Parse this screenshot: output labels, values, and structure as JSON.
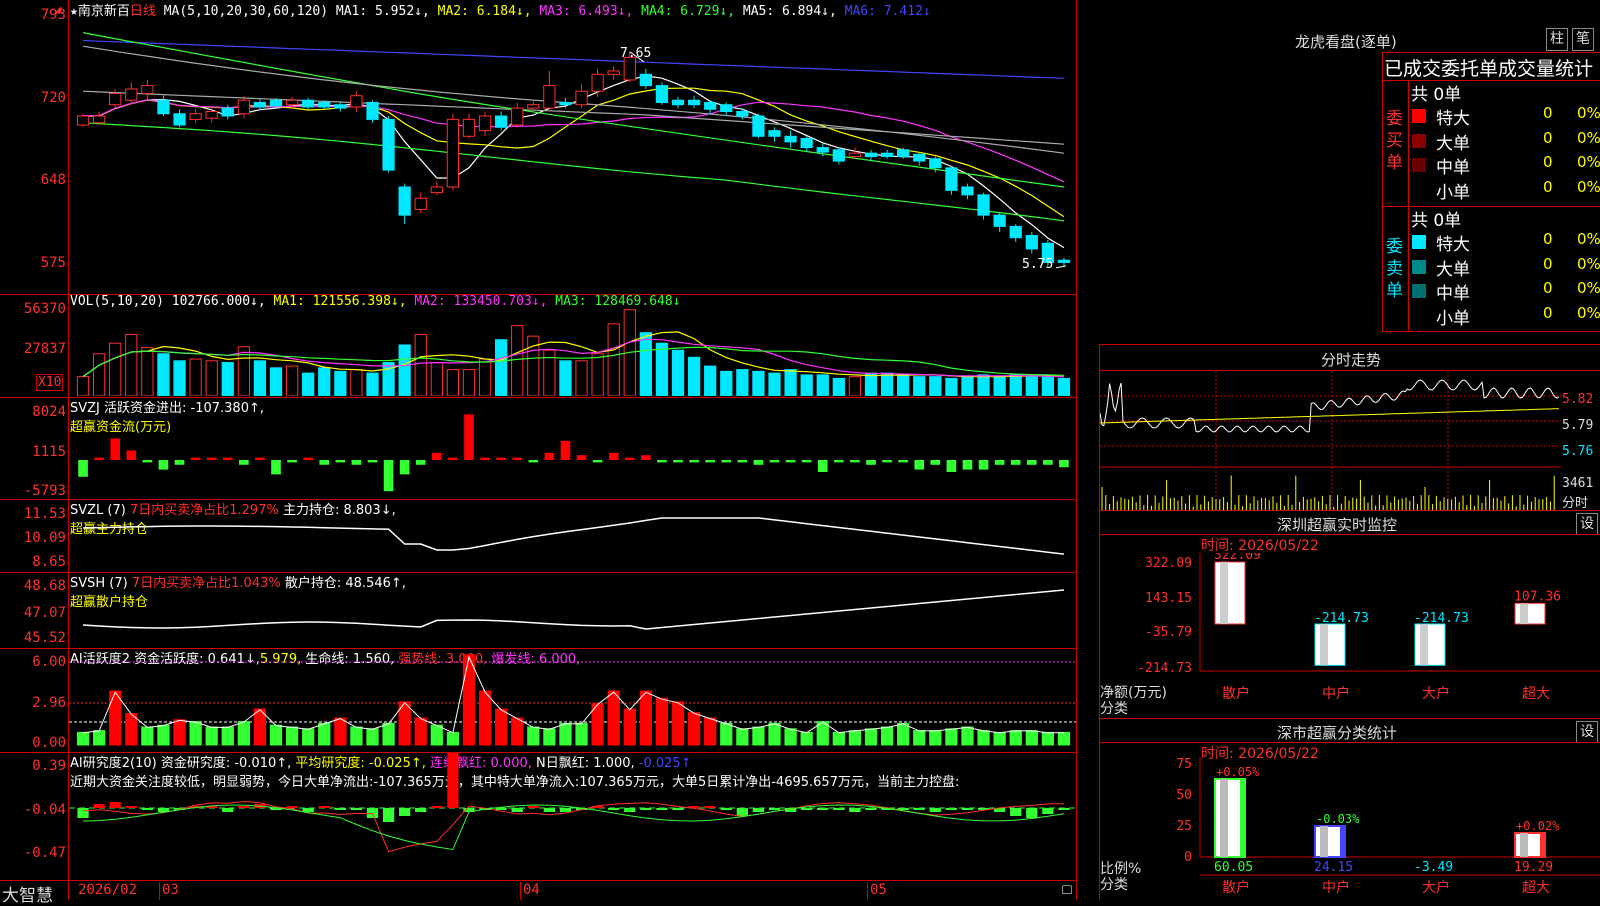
{
  "main": {
    "title_star": "★",
    "stock_name": "南京新百",
    "period": "日线",
    "ma_spec": "MA(5,10,20,30,60,120)",
    "ma1": "MA1: 5.952↓,",
    "ma2": "MA2: 6.184↓,",
    "ma3": "MA3: 6.493↓,",
    "ma4": "MA4: 6.729↓,",
    "ma5": "MA5: 6.894↓,",
    "ma6": "MA6: 7.412↓",
    "yticks": [
      "793",
      "720",
      "648",
      "575"
    ],
    "high_label": "7.65",
    "low_label": "5.75"
  },
  "vol": {
    "spec": "VOL(5,10,20)",
    "value": "102766.000↓,",
    "ma1": "MA1: 121556.398↓,",
    "ma2": "MA2: 133450.703↓,",
    "ma3": "MA3: 128469.648↓",
    "yticks": [
      "56370",
      "27837"
    ],
    "unit": "X10"
  },
  "svzj": {
    "line1": "SVZJ  活跃资金进出: -107.380↑,",
    "line2": "超赢资金流(万元)",
    "yticks": [
      "8024",
      "1115",
      "-5793"
    ]
  },
  "svzl": {
    "spec": "SVZL (7)",
    "ratio": "7日内买卖净占比1.297%",
    "hold": "主力持仓: 8.803↓,",
    "line2": "超赢主力持仓",
    "yticks": [
      "11.53",
      "10.09",
      "8.65"
    ]
  },
  "svsh": {
    "spec": "SVSH (7)",
    "ratio": "7日内买卖净占比1.043%",
    "hold": "散户持仓: 48.546↑,",
    "line2": "超赢散户持仓",
    "yticks": [
      "48.68",
      "47.07",
      "45.52"
    ]
  },
  "ai1": {
    "spec": "AI活跃度2",
    "a": "资金活跃度: 0.641↓,",
    "b": "5.979,",
    "c": "生命线: 1.560,",
    "d": "强势线: 3.000,",
    "e": "爆发线: 6.000,",
    "yticks": [
      "6.00",
      "2.96",
      "0.00"
    ]
  },
  "ai2": {
    "spec": "AI研究度2(10)",
    "a": "资金研究度: -0.010↑,",
    "b": "平均研究度: -0.025↑,",
    "c": "连续飘红: 0.000,",
    "d": "N日飘红: 1.000,",
    "e": "-0.025↑",
    "comment": "近期大资金关注度较低，明显弱势，今日大单净流出:-107.365万元，其中特大单净流入:107.365万元，大单5日累计净出-4695.657万元，当前主力控盘:",
    "yticks": [
      "0.39",
      "-0.04",
      "-0.47"
    ]
  },
  "bottom": {
    "brand": "大智慧",
    "dates": [
      "2026/02",
      "03",
      "04",
      "05"
    ]
  },
  "dragon": {
    "title": "龙虎看盘(逐单)",
    "btn_bar": "柱",
    "btn_pen": "笔",
    "header": "已成交委托单成交量统计",
    "buy_label": "委买单",
    "sell_label": "委卖单",
    "buy_total": "共 0单",
    "sell_total": "共 0单",
    "buy_rows": [
      {
        "name": "特大",
        "count": "0",
        "pct": "0%",
        "color": "#ff0000"
      },
      {
        "name": "大单",
        "count": "0",
        "pct": "0%",
        "color": "#8b0000"
      },
      {
        "name": "中单",
        "count": "0",
        "pct": "0%",
        "color": "#6b0000"
      },
      {
        "name": "小单",
        "count": "0",
        "pct": "0%",
        "color": ""
      }
    ],
    "sell_rows": [
      {
        "name": "特大",
        "count": "0",
        "pct": "0%",
        "color": "#00e8ff"
      },
      {
        "name": "大单",
        "count": "0",
        "pct": "0%",
        "color": "#008b8b"
      },
      {
        "name": "中单",
        "count": "0",
        "pct": "0%",
        "color": "#007070"
      },
      {
        "name": "小单",
        "count": "0",
        "pct": "0%",
        "color": ""
      }
    ]
  },
  "minute": {
    "title": "分时走势",
    "prices": [
      "5.82",
      "5.79",
      "5.76"
    ],
    "vol": "3461",
    "vol_unit": "分时"
  },
  "monitor": {
    "title": "深圳超赢实时监控",
    "set_btn": "设",
    "time": "时间: 2026/05/22",
    "yticks": [
      "322.09",
      "143.15",
      "-35.79",
      "-214.73"
    ],
    "ylabel1": "净额(万元)",
    "ylabel2": "分类",
    "bars": [
      {
        "label": "散户",
        "value": "322.09",
        "color": "#ff3030"
      },
      {
        "label": "中户",
        "value": "-214.73",
        "color": "#00e8ff"
      },
      {
        "label": "大户",
        "value": "-214.73",
        "color": "#00e8ff"
      },
      {
        "label": "超大",
        "value": "107.36",
        "color": "#ff3030"
      }
    ]
  },
  "classify": {
    "title": "深市超赢分类统计",
    "set_btn": "设",
    "time": "时间: 2026/05/22",
    "yticks": [
      "75",
      "50",
      "25",
      "0"
    ],
    "ylabel1": "比例%",
    "ylabel2": "分类",
    "bars": [
      {
        "label": "散户",
        "top": "+0.05%",
        "bottom": "60.05",
        "bottom_color": "#33ff33",
        "top_color": "#ff3030"
      },
      {
        "label": "中户",
        "top": "-0.03%",
        "bottom": "24.15",
        "bottom_color": "#4444ff",
        "top_color": "#33ff33"
      },
      {
        "label": "大户",
        "top": "",
        "bottom": "-3.49",
        "bottom_color": "#00e8ff",
        "top_color": "#33ff33"
      },
      {
        "label": "超大",
        "top": "+0.02%",
        "bottom": "19.29",
        "bottom_color": "#ff3030",
        "top_color": "#ff3030"
      }
    ]
  },
  "chart_data": {
    "type": "candlestick",
    "title": "南京新百 日线",
    "candles": [
      {
        "o": 7.0,
        "c": 7.08,
        "h": 7.1,
        "l": 6.98
      },
      {
        "o": 7.02,
        "c": 7.08,
        "h": 7.12,
        "l": 7.0
      },
      {
        "o": 7.18,
        "c": 7.28,
        "h": 7.32,
        "l": 7.15
      },
      {
        "o": 7.22,
        "c": 7.32,
        "h": 7.38,
        "l": 7.18
      },
      {
        "o": 7.28,
        "c": 7.35,
        "h": 7.4,
        "l": 7.22
      },
      {
        "o": 7.22,
        "c": 7.1,
        "h": 7.26,
        "l": 7.08
      },
      {
        "o": 7.1,
        "c": 7.0,
        "h": 7.14,
        "l": 6.98
      },
      {
        "o": 7.05,
        "c": 7.1,
        "h": 7.14,
        "l": 7.02
      },
      {
        "o": 7.06,
        "c": 7.12,
        "h": 7.16,
        "l": 7.02
      },
      {
        "o": 7.15,
        "c": 7.08,
        "h": 7.18,
        "l": 7.05
      },
      {
        "o": 7.1,
        "c": 7.22,
        "h": 7.26,
        "l": 7.06
      },
      {
        "o": 7.2,
        "c": 7.16,
        "h": 7.23,
        "l": 7.13
      },
      {
        "o": 7.22,
        "c": 7.17,
        "h": 7.24,
        "l": 7.15
      },
      {
        "o": 7.18,
        "c": 7.22,
        "h": 7.25,
        "l": 7.14
      },
      {
        "o": 7.22,
        "c": 7.16,
        "h": 7.24,
        "l": 7.14
      },
      {
        "o": 7.2,
        "c": 7.16,
        "h": 7.22,
        "l": 7.14
      },
      {
        "o": 7.18,
        "c": 7.15,
        "h": 7.2,
        "l": 7.12
      },
      {
        "o": 7.16,
        "c": 7.26,
        "h": 7.3,
        "l": 7.12
      },
      {
        "o": 7.2,
        "c": 7.05,
        "h": 7.22,
        "l": 7.02
      },
      {
        "o": 7.05,
        "c": 6.6,
        "h": 7.08,
        "l": 6.58
      },
      {
        "o": 6.45,
        "c": 6.2,
        "h": 6.48,
        "l": 6.12
      },
      {
        "o": 6.25,
        "c": 6.35,
        "h": 6.4,
        "l": 6.22
      },
      {
        "o": 6.4,
        "c": 6.45,
        "h": 6.5,
        "l": 6.38
      },
      {
        "o": 6.45,
        "c": 7.05,
        "h": 7.1,
        "l": 6.42
      },
      {
        "o": 6.9,
        "c": 7.05,
        "h": 7.1,
        "l": 6.88
      },
      {
        "o": 6.95,
        "c": 7.08,
        "h": 7.12,
        "l": 6.9
      },
      {
        "o": 7.08,
        "c": 6.98,
        "h": 7.12,
        "l": 6.95
      },
      {
        "o": 7.0,
        "c": 7.15,
        "h": 7.2,
        "l": 6.98
      },
      {
        "o": 7.15,
        "c": 7.18,
        "h": 7.22,
        "l": 7.12
      },
      {
        "o": 7.15,
        "c": 7.35,
        "h": 7.48,
        "l": 7.12
      },
      {
        "o": 7.2,
        "c": 7.18,
        "h": 7.24,
        "l": 7.15
      },
      {
        "o": 7.18,
        "c": 7.3,
        "h": 7.36,
        "l": 7.15
      },
      {
        "o": 7.3,
        "c": 7.45,
        "h": 7.5,
        "l": 7.25
      },
      {
        "o": 7.45,
        "c": 7.48,
        "h": 7.52,
        "l": 7.4
      },
      {
        "o": 7.4,
        "c": 7.6,
        "h": 7.65,
        "l": 7.38
      },
      {
        "o": 7.45,
        "c": 7.35,
        "h": 7.5,
        "l": 7.32
      },
      {
        "o": 7.35,
        "c": 7.2,
        "h": 7.38,
        "l": 7.18
      },
      {
        "o": 7.22,
        "c": 7.18,
        "h": 7.25,
        "l": 7.15
      },
      {
        "o": 7.22,
        "c": 7.18,
        "h": 7.26,
        "l": 7.15
      },
      {
        "o": 7.2,
        "c": 7.14,
        "h": 7.22,
        "l": 7.1
      },
      {
        "o": 7.18,
        "c": 7.12,
        "h": 7.2,
        "l": 7.08
      },
      {
        "o": 7.12,
        "c": 7.08,
        "h": 7.15,
        "l": 7.05
      },
      {
        "o": 7.08,
        "c": 6.9,
        "h": 7.1,
        "l": 6.88
      },
      {
        "o": 6.95,
        "c": 6.9,
        "h": 6.98,
        "l": 6.85
      },
      {
        "o": 6.9,
        "c": 6.85,
        "h": 6.95,
        "l": 6.8
      },
      {
        "o": 6.88,
        "c": 6.8,
        "h": 6.9,
        "l": 6.76
      },
      {
        "o": 6.8,
        "c": 6.76,
        "h": 6.84,
        "l": 6.72
      },
      {
        "o": 6.78,
        "c": 6.68,
        "h": 6.8,
        "l": 6.65
      },
      {
        "o": 6.72,
        "c": 6.75,
        "h": 6.8,
        "l": 6.7
      },
      {
        "o": 6.75,
        "c": 6.72,
        "h": 6.78,
        "l": 6.68
      },
      {
        "o": 6.75,
        "c": 6.72,
        "h": 6.78,
        "l": 6.7
      },
      {
        "o": 6.78,
        "c": 6.72,
        "h": 6.8,
        "l": 6.7
      },
      {
        "o": 6.74,
        "c": 6.68,
        "h": 6.76,
        "l": 6.64
      },
      {
        "o": 6.7,
        "c": 6.62,
        "h": 6.72,
        "l": 6.58
      },
      {
        "o": 6.62,
        "c": 6.42,
        "h": 6.64,
        "l": 6.38
      },
      {
        "o": 6.45,
        "c": 6.38,
        "h": 6.48,
        "l": 6.34
      },
      {
        "o": 6.38,
        "c": 6.2,
        "h": 6.4,
        "l": 6.16
      },
      {
        "o": 6.2,
        "c": 6.1,
        "h": 6.22,
        "l": 6.05
      },
      {
        "o": 6.1,
        "c": 6.0,
        "h": 6.12,
        "l": 5.96
      },
      {
        "o": 6.02,
        "c": 5.9,
        "h": 6.05,
        "l": 5.86
      },
      {
        "o": 5.95,
        "c": 5.78,
        "h": 5.98,
        "l": 5.75
      },
      {
        "o": 5.8,
        "c": 5.78,
        "h": 5.82,
        "l": 5.75
      }
    ],
    "ylim": [
      5.5,
      7.95
    ],
    "ma_lines": [
      {
        "name": "MA1",
        "color": "#ffffff"
      },
      {
        "name": "MA2",
        "color": "#ffff00"
      },
      {
        "name": "MA3",
        "color": "#ff33ff"
      },
      {
        "name": "MA4",
        "color": "#33ff33"
      },
      {
        "name": "MA5",
        "color": "#aaaaaa"
      },
      {
        "name": "MA6",
        "color": "#4444ff"
      }
    ]
  }
}
